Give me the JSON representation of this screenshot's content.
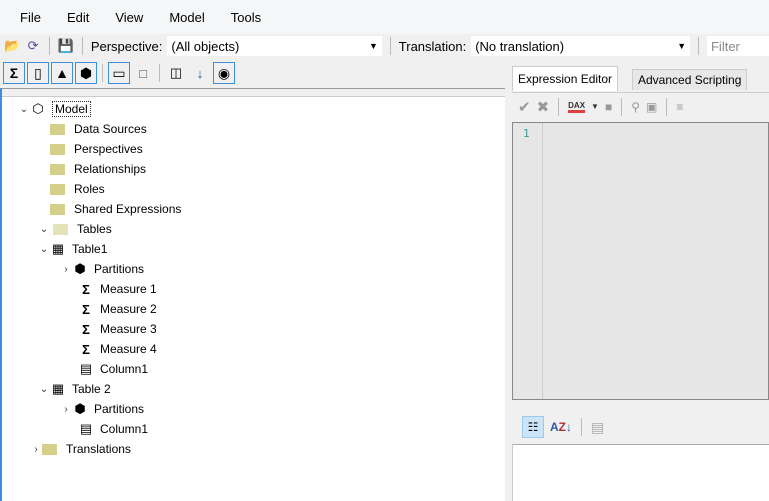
{
  "menu": [
    "File",
    "Edit",
    "View",
    "Model",
    "Tools"
  ],
  "toolbar": {
    "perspective_label": "Perspective:",
    "perspective_value": "(All objects)",
    "translation_label": "Translation:",
    "translation_value": "(No translation)",
    "filter_placeholder": "Filter"
  },
  "tree": [
    {
      "label": "Model",
      "icon": "model-icon",
      "level": 0,
      "expander": "expanded"
    },
    {
      "label": "Data Sources",
      "icon": "folder-icon",
      "level": 1
    },
    {
      "label": "Perspectives",
      "icon": "folder-icon",
      "level": 1
    },
    {
      "label": "Relationships",
      "icon": "folder-icon",
      "level": 1
    },
    {
      "label": "Roles",
      "icon": "folder-icon",
      "level": 1
    },
    {
      "label": "Shared Expressions",
      "icon": "folder-icon",
      "level": 1
    },
    {
      "label": "Tables",
      "icon": "folder-open-icon",
      "level": 1,
      "expander": "expanded"
    },
    {
      "label": "Table1",
      "icon": "table-icon",
      "level": 2,
      "expander": "expanded"
    },
    {
      "label": "Partitions",
      "icon": "partitions-icon",
      "level": 3,
      "expander": "collapsed"
    },
    {
      "label": "Measure 1",
      "icon": "measure-icon",
      "level": 3
    },
    {
      "label": "Measure 2",
      "icon": "measure-icon",
      "level": 3
    },
    {
      "label": "Measure 3",
      "icon": "measure-icon",
      "level": 3
    },
    {
      "label": "Measure 4",
      "icon": "measure-icon",
      "level": 3
    },
    {
      "label": "Column1",
      "icon": "column-icon",
      "level": 3
    },
    {
      "label": "Table 2",
      "icon": "table-icon",
      "level": 2,
      "expander": "expanded"
    },
    {
      "label": "Partitions",
      "icon": "partitions-icon",
      "level": 3,
      "expander": "collapsed"
    },
    {
      "label": "Column1",
      "icon": "column-icon",
      "level": 3
    },
    {
      "label": "Translations",
      "icon": "folder-icon",
      "level": 1,
      "expander": "collapsed",
      "x_level": 0
    }
  ],
  "tabs": [
    "Expression Editor",
    "Advanced Scripting"
  ],
  "editor": {
    "line_number": "1",
    "dax_label": "DAX"
  }
}
